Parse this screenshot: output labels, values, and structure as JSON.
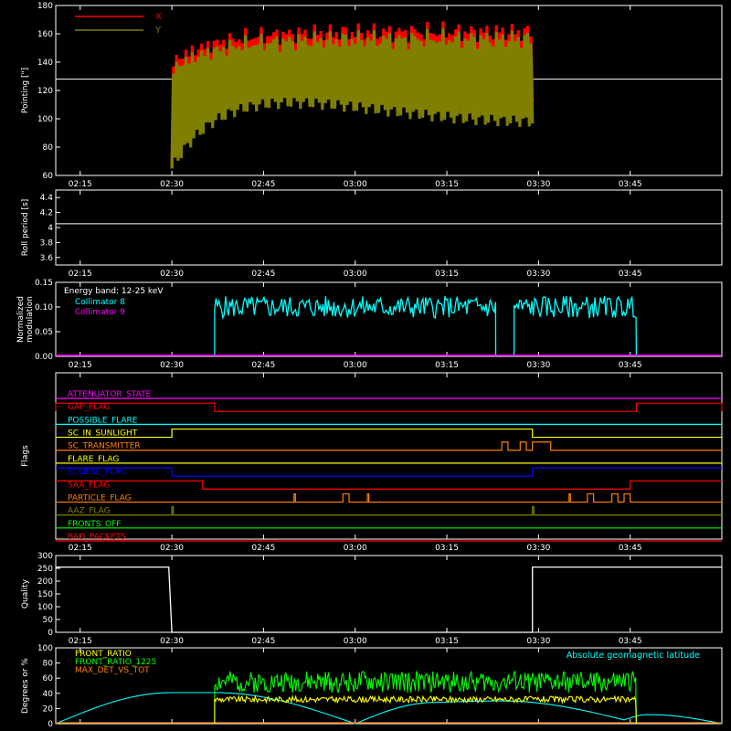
{
  "x_ticks": [
    "02:15",
    "02:30",
    "02:45",
    "03:00",
    "03:15",
    "03:30",
    "03:45"
  ],
  "chart_data": [
    {
      "id": "pointing",
      "type": "line",
      "ylabel": "Pointing [\"]",
      "ylim": [
        60,
        180
      ],
      "yticks": [
        60,
        80,
        100,
        120,
        140,
        160,
        180
      ],
      "x_range": [
        "02:11",
        "04:00"
      ],
      "reference_line": 128,
      "legend": [
        {
          "name": "X",
          "color": "#ff0000"
        },
        {
          "name": "Y",
          "color": "#808000"
        }
      ],
      "series": [
        {
          "name": "X",
          "color": "#ff0000",
          "start": "02:30",
          "end": "03:29",
          "envelope": {
            "upper_range": [
              140,
              165
            ],
            "lower_range": [
              65,
              145
            ]
          }
        },
        {
          "name": "Y",
          "color": "#808000",
          "start": "02:30",
          "end": "03:29",
          "envelope": {
            "upper_range": [
              135,
              160
            ],
            "lower_range": [
              65,
              120
            ]
          }
        }
      ]
    },
    {
      "id": "roll",
      "type": "line",
      "ylabel": "Roll period [s]",
      "ylim": [
        3.5,
        4.5
      ],
      "yticks": [
        3.6,
        3.8,
        4.0,
        4.2,
        4.4
      ],
      "series": [
        {
          "name": "roll",
          "color": "#ffffff",
          "value": 4.05
        }
      ]
    },
    {
      "id": "modulation",
      "type": "line",
      "ylabel_lines": [
        "Normalized",
        "modulation"
      ],
      "ylim": [
        0,
        0.15
      ],
      "yticks": [
        "0.00",
        "0.05",
        "0.10",
        "0.15"
      ],
      "annotation": "Energy band: 12-25 keV",
      "legend": [
        {
          "name": "Collimator 8",
          "color": "#00ffff"
        },
        {
          "name": "Collimator 9",
          "color": "#ff00ff"
        }
      ],
      "series": [
        {
          "name": "Collimator 8",
          "color": "#00ffff",
          "segments": [
            [
              "02:37",
              "03:23",
              0.1
            ],
            [
              "03:26",
              "03:46",
              0.1
            ]
          ]
        },
        {
          "name": "Collimator 9",
          "color": "#ff00ff",
          "value": 0
        }
      ]
    },
    {
      "id": "flags",
      "type": "line",
      "ylabel": "Flags",
      "series": [
        {
          "name": "ATTENUATOR_STATE",
          "color": "#ff00ff",
          "base": 0,
          "segments": []
        },
        {
          "name": "GAP_FLAG",
          "color": "#ff0000",
          "base": 0,
          "segments": [
            [
              "02:11",
              "02:37"
            ],
            [
              "03:46",
              "04:00"
            ]
          ]
        },
        {
          "name": "POSSIBLE_FLARE",
          "color": "#00ffff",
          "base": 0,
          "segments": []
        },
        {
          "name": "SC_IN_SUNLIGHT",
          "color": "#ffff00",
          "base": 0,
          "segments": [
            [
              "02:30",
              "03:29"
            ]
          ]
        },
        {
          "name": "SC_TRANSMITTER",
          "color": "#ff8000",
          "base": 0,
          "segments": [
            [
              "03:24",
              "03:25"
            ],
            [
              "03:27",
              "03:28"
            ],
            [
              "03:29",
              "03:32"
            ]
          ]
        },
        {
          "name": "FLARE_FLAG",
          "color": "#ffff00",
          "base": 0,
          "segments": []
        },
        {
          "name": "ECLIPSE_FLAG",
          "color": "#0000ff",
          "base": 1,
          "segments": [
            [
              "02:30",
              "03:29"
            ]
          ]
        },
        {
          "name": "SAA_FLAG",
          "color": "#ff0000",
          "base": 1,
          "segments": [
            [
              "02:35",
              "03:45"
            ]
          ]
        },
        {
          "name": "PARTICLE_FLAG",
          "color": "#ff8000",
          "base": 0,
          "segments": [
            [
              "02:50",
              "02:50"
            ],
            [
              "02:58",
              "02:59"
            ],
            [
              "03:02",
              "03:02"
            ],
            [
              "03:35",
              "03:35"
            ],
            [
              "03:38",
              "03:39"
            ],
            [
              "03:42",
              "03:43"
            ],
            [
              "03:44",
              "03:45"
            ]
          ]
        },
        {
          "name": "AAZ_FLAG",
          "color": "#808000",
          "base": 0,
          "segments": [
            [
              "02:30",
              "02:30"
            ],
            [
              "03:29",
              "03:29"
            ]
          ]
        },
        {
          "name": "FRONTS_OFF",
          "color": "#00ff00",
          "base": 0,
          "segments": []
        },
        {
          "name": "BAD_PACKETS",
          "color": "#ff0000",
          "base": 0,
          "segments": []
        }
      ]
    },
    {
      "id": "quality",
      "type": "line",
      "ylabel": "Quality",
      "ylim": [
        0,
        300
      ],
      "yticks": [
        0,
        50,
        100,
        150,
        200,
        250,
        300
      ],
      "series": [
        {
          "name": "quality",
          "color": "#ffffff",
          "points": [
            [
              "02:11",
              255
            ],
            [
              "02:29.5",
              255
            ],
            [
              "02:30",
              0
            ],
            [
              "03:29",
              0
            ],
            [
              "03:29",
              255
            ],
            [
              "04:00",
              255
            ]
          ]
        }
      ]
    },
    {
      "id": "ratios",
      "type": "line",
      "ylabel": "Degrees or %",
      "ylim": [
        0,
        100
      ],
      "yticks": [
        0,
        20,
        40,
        60,
        80,
        100
      ],
      "legend": [
        {
          "name": "FRONT_RATIO",
          "color": "#ffff00"
        },
        {
          "name": "FRONT_RATIO_1225",
          "color": "#00ff00"
        },
        {
          "name": "MAX_DET_VS_TOT",
          "color": "#ff8000"
        }
      ],
      "annotation": "Absolute geomagnetic latitude",
      "annotation_color": "#00ffff",
      "series": [
        {
          "name": "FRONT_RATIO",
          "color": "#ffff00",
          "segments": [
            [
              "02:37",
              "03:46",
              32
            ]
          ]
        },
        {
          "name": "FRONT_RATIO_1225",
          "color": "#00ff00",
          "segments": [
            [
              "02:37",
              "03:46",
              55
            ]
          ]
        },
        {
          "name": "MAX_DET_VS_TOT",
          "color": "#ff8000",
          "value": 0
        },
        {
          "name": "Absolute geomagnetic latitude",
          "color": "#00ffff",
          "points": [
            [
              "02:11",
              0
            ],
            [
              "02:30",
              41
            ],
            [
              "02:37",
              41
            ],
            [
              "03:00",
              0
            ],
            [
              "03:13",
              28
            ],
            [
              "03:24",
              30
            ],
            [
              "03:44",
              5
            ],
            [
              "03:48",
              12
            ],
            [
              "04:00",
              0
            ]
          ]
        }
      ]
    }
  ]
}
